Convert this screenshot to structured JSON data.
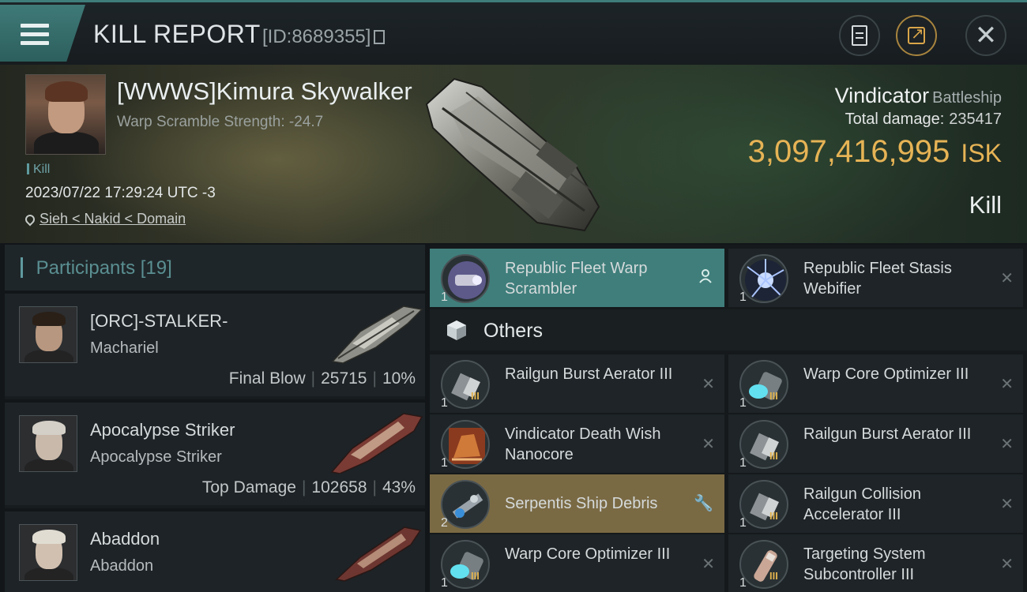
{
  "header": {
    "title": "KILL REPORT",
    "report_id": "[ID:8689355]"
  },
  "victim": {
    "name": "[WWWS]Kimura Skywalker",
    "warp_scramble": "Warp Scramble Strength: -24.7",
    "kill_tag": "Kill",
    "datetime": "2023/07/22 17:29:24 UTC -3",
    "location": "Sieh < Nakid < Domain",
    "ship_name": "Vindicator",
    "ship_class": "Battleship",
    "total_damage_label": "Total damage:",
    "total_damage": "235417",
    "isk_value": "3,097,416,995",
    "isk_unit": "ISK",
    "result_label": "Kill"
  },
  "participants": {
    "title": "Participants",
    "count": "[19]",
    "items": [
      {
        "name": "[ORC]-STALKER-",
        "ship": "Machariel",
        "stat_label": "Final Blow",
        "damage": "25715",
        "percent": "10%"
      },
      {
        "name": "Apocalypse Striker",
        "ship": "Apocalypse Striker",
        "stat_label": "Top Damage",
        "damage": "102658",
        "percent": "43%"
      },
      {
        "name": "Abaddon",
        "ship": "Abaddon"
      }
    ]
  },
  "modules": {
    "others_label": "Others",
    "top": [
      {
        "name": "Republic Fleet Warp Scrambler",
        "qty": "1",
        "icon": "warp-scrambler-icon",
        "status": "person-icon"
      },
      {
        "name": "Republic Fleet Stasis Webifier",
        "qty": "1",
        "icon": "stasis-webifier-icon",
        "status": "close-icon"
      }
    ],
    "others": [
      {
        "name": "Railgun Burst Aerator III",
        "qty": "1",
        "tier": "III"
      },
      {
        "name": "Warp Core Optimizer III",
        "qty": "1",
        "tier": "III"
      },
      {
        "name": "Vindicator Death Wish Nanocore",
        "qty": "1",
        "tier": ""
      },
      {
        "name": "Railgun Burst Aerator III",
        "qty": "1",
        "tier": "III"
      },
      {
        "name": "Serpentis Ship Debris",
        "qty": "2",
        "tier": ""
      },
      {
        "name": "Railgun Collision Accelerator III",
        "qty": "1",
        "tier": "III"
      },
      {
        "name": "Warp Core Optimizer III",
        "qty": "1",
        "tier": "III"
      },
      {
        "name": "Targeting System Subcontroller III",
        "qty": "1",
        "tier": "III"
      }
    ]
  },
  "colors": {
    "accent_teal": "#3f7e7b",
    "isk_gold": "#e6b355",
    "dropped_gold": "#7a6a44"
  }
}
